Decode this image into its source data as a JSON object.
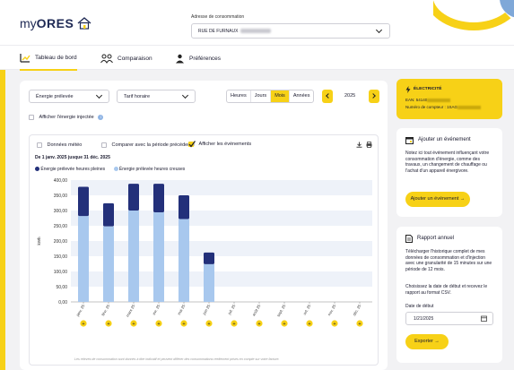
{
  "header": {
    "logo_prefix": "my",
    "logo_brand": "ORES",
    "address_label": "Adresse de consommation",
    "address_value": "RUE DE FURNAUX"
  },
  "nav": {
    "tabs": [
      {
        "label": "Tableau de bord",
        "icon": "gauge-icon",
        "active": true
      },
      {
        "label": "Comparaison",
        "icon": "people-icon",
        "active": false
      },
      {
        "label": "Préférences",
        "icon": "user-settings-icon",
        "active": false
      }
    ]
  },
  "filters": {
    "energy_select": "Énergie prélevée",
    "tariff_select": "Tarif horaire",
    "periods": [
      "Heures",
      "Jours",
      "Mois",
      "Années"
    ],
    "active_period": "Mois",
    "year": "2025",
    "show_injected_label": "Afficher l'énergie injectée"
  },
  "chart_options": {
    "weather_label": "Données météo",
    "compare_label": "Comparer avec la période précédente",
    "events_label": "Afficher les événements",
    "date_range": "De 1 janv. 2025 jusque 31 déc. 2025",
    "footnote": "Les relevés de consommation sont donnés à titre indicatif et peuvent différer des consommations réellement prises en compte sur votre facture."
  },
  "chart_data": {
    "type": "bar",
    "stacked": true,
    "ylabel": "kWh",
    "ylim": [
      0,
      400
    ],
    "yticks": [
      "0,00",
      "50,00",
      "100,00",
      "150,00",
      "200,00",
      "250,00",
      "300,00",
      "350,00",
      "400,00"
    ],
    "categories": [
      "janv. 25",
      "févr. 25",
      "mars 25",
      "avr. 25",
      "mai 25",
      "juin 25",
      "juil. 25",
      "août 25",
      "sept. 25",
      "oct. 25",
      "nov. 25",
      "déc. 25"
    ],
    "series": [
      {
        "name": "Énergie prélevée heures creuses",
        "color": "#a8c8ee",
        "values": [
          282,
          248,
          300,
          294,
          272,
          124,
          0,
          0,
          0,
          0,
          0,
          0
        ]
      },
      {
        "name": "Énergie prélevée heures pleines",
        "color": "#23307a",
        "values": [
          96,
          76,
          88,
          94,
          78,
          38,
          0,
          0,
          0,
          0,
          0,
          0
        ]
      }
    ],
    "legend_position": "top-left",
    "grid": true
  },
  "electricity": {
    "title": "ÉLECTRICITÉ",
    "ean_label": "EAN: 54140",
    "meter_label": "Numéro de compteur : 1SAG"
  },
  "event_card": {
    "title": "Ajouter un événement",
    "text": "Notez ici tout événement influençant votre consommation d'énergie, comme des travaux, un changement de chauffage ou l'achat d'un appareil énergivore.",
    "button": "Ajouter un événement"
  },
  "report_card": {
    "title": "Rapport annuel",
    "text1": "Télécharger l'historique complet de mes données de consommation et d'injection avec une granularité de 15 minutes sur une période de 12 mois.",
    "text2": "Choisissez la date de début et recevez le rapport au format CSV.",
    "date_label": "Date de début",
    "date_value": "1/21/2025",
    "button": "Exporter"
  },
  "colors": {
    "accent": "#f7d117",
    "navy": "#23307a",
    "light_blue": "#a8c8ee"
  }
}
